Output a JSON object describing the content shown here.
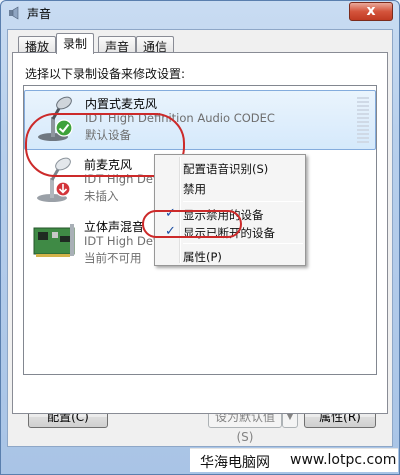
{
  "window": {
    "title": "声音",
    "close_glyph": "x"
  },
  "tabs": [
    {
      "label": "播放",
      "active": false
    },
    {
      "label": "录制",
      "active": true
    },
    {
      "label": "声音",
      "active": false
    },
    {
      "label": "通信",
      "active": false
    }
  ],
  "instruction": "选择以下录制设备来修改设置:",
  "devices": [
    {
      "name": "内置式麦克风",
      "driver": "IDT High Definition Audio CODEC",
      "status": "默认设备",
      "icon": "microphone-icon",
      "badge": "check-badge-icon",
      "selected": true
    },
    {
      "name": "前麦克风",
      "driver": "IDT High Defini",
      "status": "未插入",
      "icon": "microphone-icon",
      "badge": "down-arrow-badge-icon",
      "selected": false
    },
    {
      "name": "立体声混音",
      "driver": "IDT High Defini",
      "status": "当前不可用",
      "icon": "sound-card-icon",
      "badge": "",
      "selected": false
    }
  ],
  "context_menu": {
    "items": [
      {
        "label": "配置语音识别(S)",
        "checked": false
      },
      {
        "label": "禁用",
        "checked": false
      },
      {
        "label": "显示禁用的设备",
        "checked": true
      },
      {
        "label": "显示已断开的设备",
        "checked": true
      },
      {
        "label": "属性(P)",
        "checked": false
      }
    ],
    "check_glyph": "✓"
  },
  "buttons": {
    "configure": "配置(C)",
    "set_default": "设为默认值(S)",
    "dropdown_glyph": "▼",
    "properties": "属性(R)"
  },
  "watermark": {
    "text": "华海电脑网",
    "url": "www.lotpc.com"
  },
  "colors": {
    "annotation": "#cc2a2a",
    "selection": "#d5e9fb",
    "titlebar": "#b7cfec",
    "close": "#d4543c"
  }
}
